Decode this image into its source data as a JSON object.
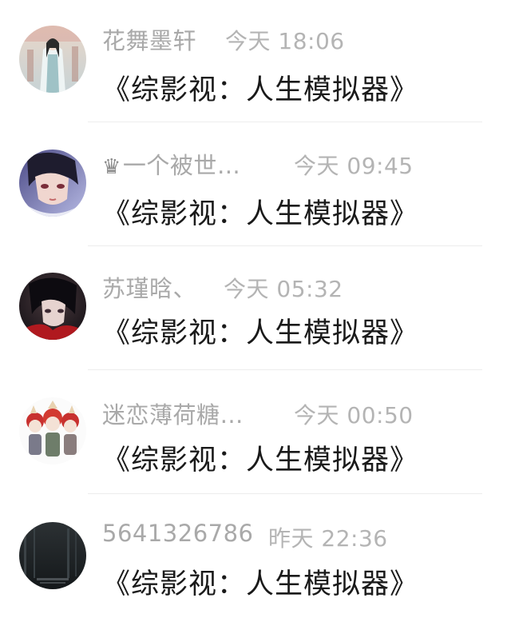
{
  "conversations": [
    {
      "name": "花舞墨轩",
      "time": "今天 18:06",
      "message": "《综影视：人生模拟器》",
      "avatar_icon": "avatar-ancient-robed-figure"
    },
    {
      "name": "一个被世…",
      "name_prefix_icon": "♛",
      "time": "今天 09:45",
      "message": "《综影视：人生模拟器》",
      "avatar_icon": "avatar-anime-boy"
    },
    {
      "name": "苏瑾晗、",
      "time": "今天 05:32",
      "message": "《综影视：人生模拟器》",
      "avatar_icon": "avatar-anime-dark-haired-man"
    },
    {
      "name": "迷恋薄荷糖…",
      "time": "今天 00:50",
      "message": "《综影视：人生模拟器》",
      "avatar_icon": "avatar-chibi-group"
    },
    {
      "name": "5641326786",
      "time": "昨天 22:36",
      "message": "《综影视：人生模拟器》",
      "avatar_icon": "avatar-dark-photo"
    }
  ]
}
